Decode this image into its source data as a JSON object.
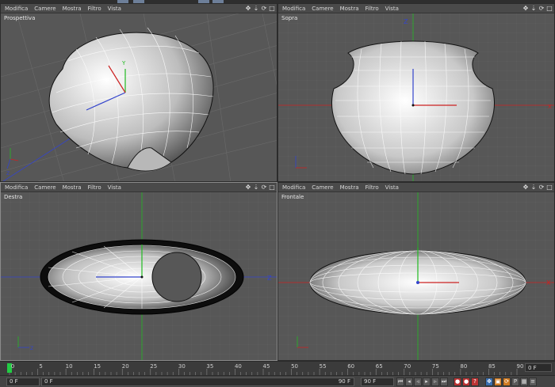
{
  "menu": {
    "modifica": "Modifica",
    "camere": "Camere",
    "mostra": "Mostra",
    "filtro": "Filtro",
    "vista": "Vista"
  },
  "viewports": {
    "perspective": "Prospettiva",
    "top": "Sopra",
    "right": "Destra",
    "front": "Frontale"
  },
  "axis": {
    "x": "X",
    "y": "Y",
    "z": "Z"
  },
  "timeline": {
    "ticks": [
      "0",
      "5",
      "10",
      "15",
      "20",
      "25",
      "30",
      "35",
      "40",
      "45",
      "50",
      "55",
      "60",
      "65",
      "70",
      "75",
      "80",
      "85",
      "90"
    ],
    "current_frame": "0 F"
  },
  "bottombar": {
    "start_frame": "0 F",
    "range_start": "0 F",
    "range_end": "90 F",
    "end_frame": "90 F"
  },
  "colors": {
    "viewport_bg": "#575757",
    "grid": "#666666",
    "axis_x": "#cc2222",
    "axis_y": "#22bb22",
    "axis_z": "#3344cc"
  }
}
